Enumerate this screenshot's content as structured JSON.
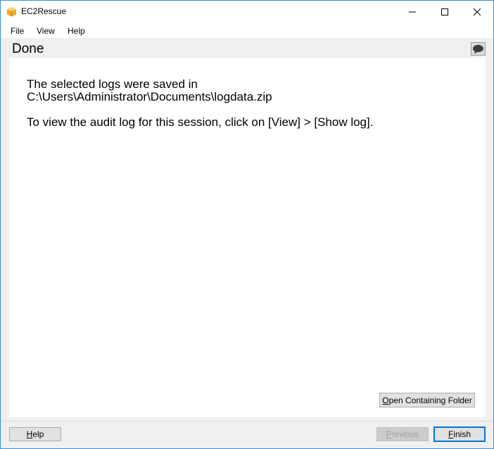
{
  "window": {
    "title": "EC2Rescue"
  },
  "menu": {
    "file": "File",
    "view": "View",
    "help": "Help"
  },
  "header": {
    "title": "Done"
  },
  "content": {
    "line1": "The selected logs were saved in",
    "line2": "C:\\Users\\Administrator\\Documents\\logdata.zip",
    "line3": "To view the audit log for this session, click on [View] > [Show log]."
  },
  "buttons": {
    "open_folder": {
      "underline": "O",
      "rest": "pen Containing Folder"
    },
    "help": {
      "underline": "H",
      "rest": "elp"
    },
    "previous": {
      "underline": "P",
      "rest": "revious"
    },
    "finish": {
      "underline": "F",
      "rest": "inish"
    }
  },
  "icons": {
    "app": "ec2rescue-box-icon",
    "minimize": "minimize-icon",
    "maximize": "maximize-icon",
    "close": "close-icon",
    "feedback": "speech-bubble-icon"
  },
  "colors": {
    "accent": "#0078d7",
    "app_icon": "#f5a623"
  }
}
